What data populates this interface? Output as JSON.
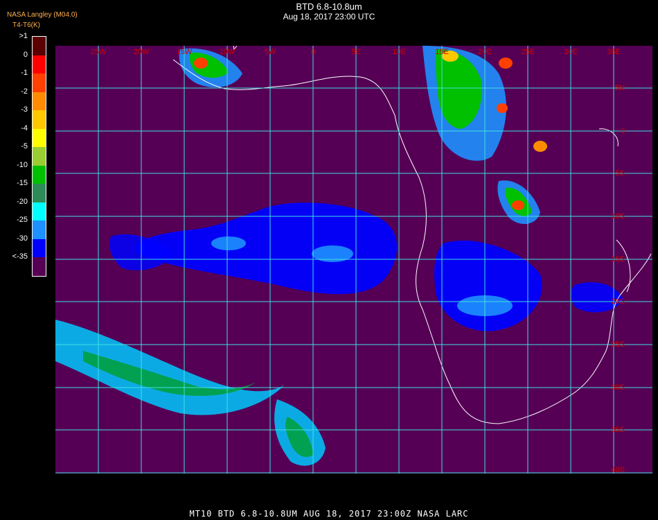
{
  "header": {
    "title": "BTD 6.8-10.8um",
    "datetime": "Aug 18, 2017 23:00 UTC",
    "credit": "NASA Langley (M04.0)",
    "overlay_label": "BTD",
    "unit_label": "T4-T6(K)"
  },
  "colorbar": {
    "labels": [
      ">1",
      "0",
      "-1",
      "-2",
      "-3",
      "-4",
      "-5",
      "-10",
      "-15",
      "-20",
      "-25",
      "-30",
      "<-35"
    ],
    "colors": [
      "#5a0000",
      "#ff0000",
      "#ff4000",
      "#ff8c00",
      "#ffc800",
      "#ffff00",
      "#9acd32",
      "#00c000",
      "#2e8b57",
      "#00ffff",
      "#1e90ff",
      "#0000ff",
      "#550055"
    ]
  },
  "map": {
    "background_color": "#550055",
    "grid_color": "#40e0e0",
    "coast_color": "#ffffff",
    "longitude_labels": [
      "25W",
      "20W",
      "15W",
      "10W",
      "5W",
      "0",
      "5E",
      "10E",
      "15E",
      "20E",
      "25E",
      "30E",
      "35E"
    ],
    "latitude_labels": [
      "5N",
      "0",
      "5S",
      "10S",
      "15S",
      "20S",
      "25S",
      "30S",
      "35S",
      "40S"
    ]
  },
  "footer": {
    "text": "MT10  BTD 6.8-10.8UM   AUG 18, 2017 23:00Z   NASA LARC"
  }
}
